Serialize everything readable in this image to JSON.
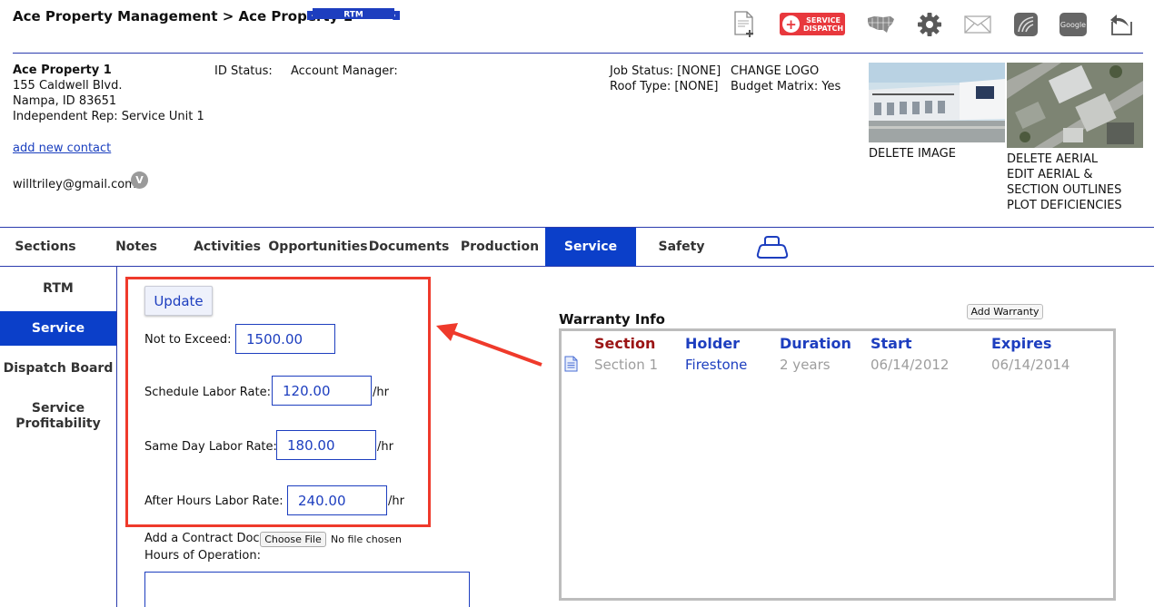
{
  "header": {
    "title": "Ace Property Management > Ace Property 1",
    "badge": "RTM",
    "icons": [
      "new-document-icon",
      "service-dispatch-icon",
      "usa-map-icon",
      "gear-icon",
      "envelope-icon",
      "sketch-icon",
      "google-icon",
      "back-icon"
    ],
    "service_dispatch_line1": "SERVICE",
    "service_dispatch_line2": "DISPATCH",
    "google_label": "Google"
  },
  "property": {
    "name": "Ace Property 1",
    "address1": "155 Caldwell Blvd.",
    "address2": "Nampa, ID 83651",
    "rep": "Independent Rep: Service Unit 1",
    "add_contact": "add new contact",
    "email": "willtriley@gmail.com",
    "badge": "V",
    "id_status": "ID Status:",
    "account_manager": "Account Manager:",
    "job_status": "Job Status: [NONE]",
    "roof_type": "Roof Type: [NONE]",
    "change_logo": "CHANGE LOGO",
    "budget_matrix": "Budget Matrix: Yes",
    "delete_image": "DELETE IMAGE",
    "aerial_links": [
      "DELETE AERIAL",
      "EDIT AERIAL &",
      "SECTION OUTLINES",
      "PLOT DEFICIENCIES"
    ]
  },
  "tabs": [
    "Sections",
    "Notes",
    "Activities",
    "Opportunities",
    "Documents",
    "Production",
    "Service",
    "Safety"
  ],
  "active_tab": "Service",
  "sidebar": {
    "items": [
      "RTM",
      "Service",
      "Dispatch Board",
      "Service",
      "Profitability"
    ]
  },
  "form": {
    "update_label": "Update",
    "not_to_exceed_label": "Not to Exceed: $",
    "not_to_exceed_value": "1500.00",
    "schedule_label": "Schedule Labor Rate: $",
    "schedule_value": "120.00",
    "same_day_label": "Same Day Labor Rate: $",
    "same_day_value": "180.00",
    "after_hours_label": "After Hours Labor Rate: $",
    "after_hours_value": "240.00",
    "per_hour": "/hr",
    "contract_doc_label": "Add a Contract Doc:",
    "choose_file": "Choose File",
    "no_file": "No file chosen",
    "hours_label": "Hours of Operation:"
  },
  "warranty": {
    "title": "Warranty Info",
    "add_button": "Add Warranty",
    "headers": [
      "Section",
      "Holder",
      "Duration",
      "Start",
      "Expires"
    ],
    "rows": [
      {
        "section": "Section 1",
        "holder": "Firestone",
        "duration": "2 years",
        "start": "06/14/2012",
        "expires": "06/14/2014"
      }
    ]
  },
  "colors": {
    "accent": "#0b3fc9",
    "highlight": "#ef3a2b",
    "section_header": "#9b1414"
  }
}
